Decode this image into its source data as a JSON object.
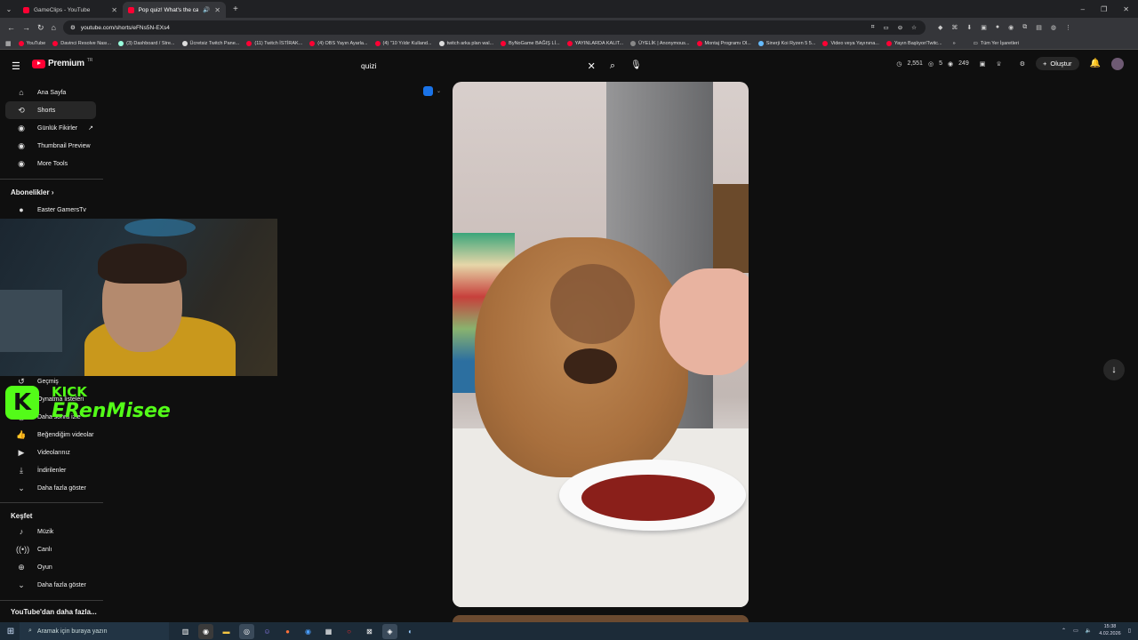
{
  "browser": {
    "tabs": [
      {
        "title": "GameClips - YouTube",
        "active": false
      },
      {
        "title": "Pop quiz! What's the capyb",
        "active": true
      }
    ],
    "url": "youtube.com/shorts/eFNs5N-EXs4",
    "bookmarks": [
      "YouTube",
      "Davinci Resolve Nası...",
      "(3) Dashboard / Stre...",
      "Ücretsiz Twitch Pane...",
      "(11) Twitch İSTİRAK...",
      "(4) OBS Yayın Ayarla...",
      "(4) \"10 Yıldır Kulland...",
      "twitch arka plan wal...",
      "ByNoGame BAĞIŞ Lİ...",
      "YAYINLARDA KALIT...",
      "ÜYELİK | Anonymous...",
      "Montaj Programı Ol...",
      "Sinerji Koi Ryzen 5 5...",
      "Video veya Yayınına...",
      "Yayın Başlıyor/Twitc..."
    ],
    "all_bookmarks": "Tüm Yer İşaretleri"
  },
  "youtube": {
    "logo_text": "Premium",
    "logo_sup": "TR",
    "search_query": "quizi",
    "stats": {
      "a": "2,551",
      "b": "5",
      "c": "249"
    },
    "create_label": "Oluştur"
  },
  "sidebar": {
    "top": [
      {
        "label": "Ana Sayfa",
        "icon": "home-icon"
      },
      {
        "label": "Shorts",
        "icon": "shorts-icon"
      },
      {
        "label": "Günlük Fikirler",
        "icon": "extension-icon"
      },
      {
        "label": "Thumbnail Preview",
        "icon": "extension-icon"
      },
      {
        "label": "More Tools",
        "icon": "extension-icon"
      }
    ],
    "subs_heading": "Abonelikler",
    "subs": [
      {
        "label": "Easter GamersTv"
      }
    ],
    "you": [
      {
        "label": "Geçmiş",
        "icon": "history-icon"
      },
      {
        "label": "Oynatma listeleri",
        "icon": "playlist-icon"
      },
      {
        "label": "Daha sonra izle",
        "icon": "clock-icon"
      },
      {
        "label": "Beğendiğim videolar",
        "icon": "like-icon"
      },
      {
        "label": "Videolarınız",
        "icon": "video-icon"
      },
      {
        "label": "İndirilenler",
        "icon": "download-icon"
      },
      {
        "label": "Daha fazla göster",
        "icon": "chevron-down-icon"
      }
    ],
    "explore_heading": "Keşfet",
    "explore": [
      {
        "label": "Müzik",
        "icon": "music-icon"
      },
      {
        "label": "Canlı",
        "icon": "live-icon"
      },
      {
        "label": "Oyun",
        "icon": "gaming-icon"
      },
      {
        "label": "Daha fazla göster",
        "icon": "chevron-down-icon"
      }
    ],
    "more_heading": "YouTube'dan daha fazla..."
  },
  "overlay": {
    "kick_letter": "K",
    "kick_label": "KICK",
    "streamer": "ERenMisee"
  },
  "taskbar": {
    "search_placeholder": "Aramak için buraya yazın",
    "time": "15:38",
    "date": "4.02.2026"
  }
}
